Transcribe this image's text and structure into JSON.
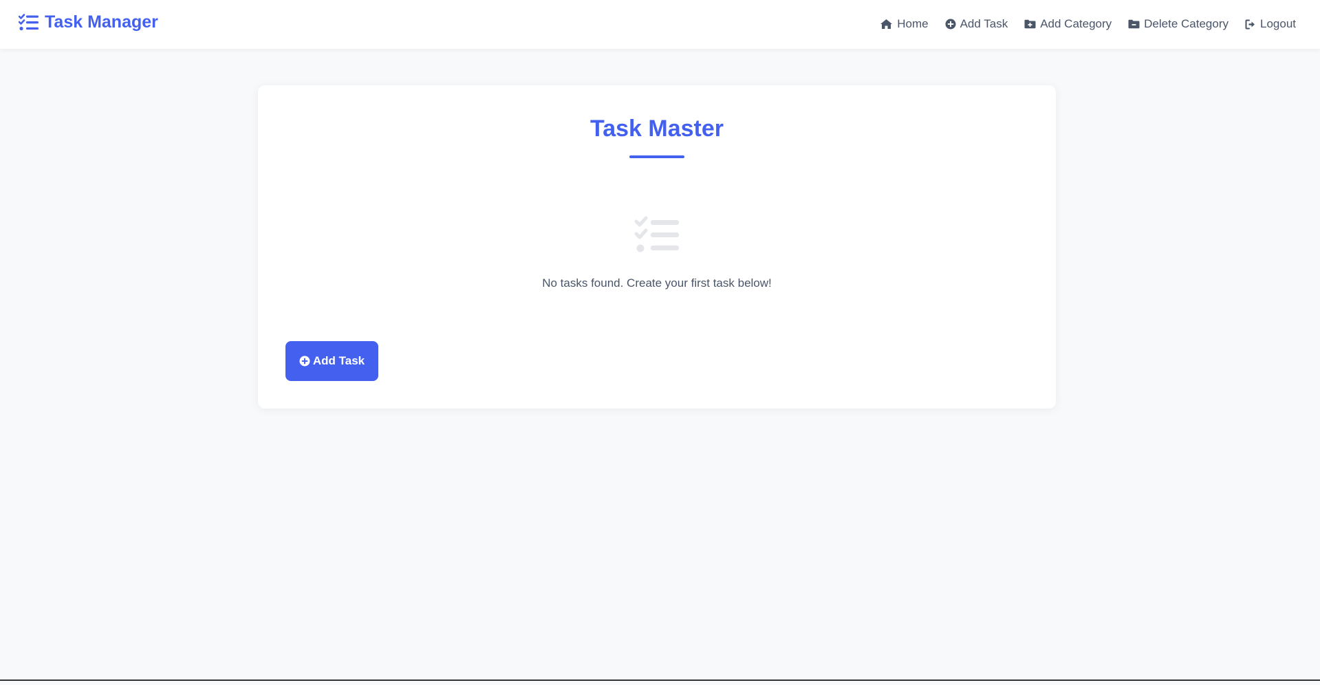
{
  "brand": {
    "title": "Task Manager",
    "icon": "list-check-icon"
  },
  "nav": {
    "items": [
      {
        "label": "Home",
        "icon": "home-icon"
      },
      {
        "label": "Add Task",
        "icon": "plus-circle-icon"
      },
      {
        "label": "Add Category",
        "icon": "folder-plus-icon"
      },
      {
        "label": "Delete Category",
        "icon": "folder-minus-icon"
      },
      {
        "label": "Logout",
        "icon": "logout-icon"
      }
    ]
  },
  "main": {
    "title": "Task Master",
    "empty_icon": "tasks-icon",
    "empty_message": "No tasks found. Create your first task below!",
    "add_button_label": "Add Task"
  },
  "colors": {
    "accent": "#4361ee",
    "nav_text": "#4a5568",
    "background": "#f8f9fb",
    "card": "#ffffff"
  }
}
